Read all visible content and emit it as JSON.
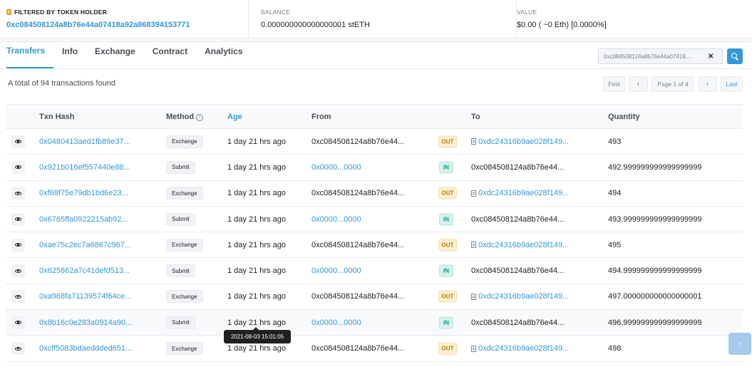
{
  "summary": {
    "filter_label": "FILTERED BY TOKEN HOLDER",
    "holder_address": "0xc084508124a8b76e44a07418a92a868394153771",
    "balance_label": "BALANCE",
    "balance_value": "0.000000000000000001 stETH",
    "value_label": "VALUE",
    "value_value": "$0.00 ( ~0 Eth) [0.0000%]"
  },
  "tabs": [
    "Transfers",
    "Info",
    "Exchange",
    "Contract",
    "Analytics"
  ],
  "active_tab": "Transfers",
  "search": {
    "value": "0xc084508124a8b76e44a07418..."
  },
  "total_text": "A total of 94 transactions found",
  "pager": {
    "first": "First",
    "prev": "‹",
    "page": "Page 1 of 4",
    "next": "›",
    "last": "Last"
  },
  "table": {
    "headers": {
      "hash": "Txn Hash",
      "method": "Method",
      "age": "Age",
      "from": "From",
      "to": "To",
      "qty": "Quantity"
    },
    "rows": [
      {
        "hash": "0x0480413aed1fb89e37...",
        "method": "Exchange",
        "age": "1 day 21 hrs ago",
        "from": "0xc084508124a8b76e44...",
        "from_link": false,
        "dir": "OUT",
        "to": "0xdc24316b9ae028f149...",
        "to_link": true,
        "qty": "493"
      },
      {
        "hash": "0x921b016ef557440e88...",
        "method": "Submit",
        "age": "1 day 21 hrs ago",
        "from": "0x0000...0000",
        "from_link": true,
        "dir": "IN",
        "to": "0xc084508124a8b76e44...",
        "to_link": false,
        "qty": "492.999999999999999999"
      },
      {
        "hash": "0xf68f75e79db1bd6e23...",
        "method": "Exchange",
        "age": "1 day 21 hrs ago",
        "from": "0xc084508124a8b76e44...",
        "from_link": false,
        "dir": "OUT",
        "to": "0xdc24316b9ae028f149...",
        "to_link": true,
        "qty": "494"
      },
      {
        "hash": "0x6765ffa0922215ab92...",
        "method": "Submit",
        "age": "1 day 21 hrs ago",
        "from": "0x0000...0000",
        "from_link": true,
        "dir": "IN",
        "to": "0xc084508124a8b76e44...",
        "to_link": false,
        "qty": "493.999999999999999999"
      },
      {
        "hash": "0xae75c2ec7a6867c967...",
        "method": "Exchange",
        "age": "1 day 21 hrs ago",
        "from": "0xc084508124a8b76e44...",
        "from_link": false,
        "dir": "OUT",
        "to": "0xdc24316b9ae028f149...",
        "to_link": true,
        "qty": "495"
      },
      {
        "hash": "0x625862a7c41defd513...",
        "method": "Submit",
        "age": "1 day 21 hrs ago",
        "from": "0x0000...0000",
        "from_link": true,
        "dir": "IN",
        "to": "0xc084508124a8b76e44...",
        "to_link": false,
        "qty": "494.999999999999999999"
      },
      {
        "hash": "0xa968fa71139574f64ce...",
        "method": "Exchange",
        "age": "1 day 21 hrs ago",
        "from": "0xc084508124a8b76e44...",
        "from_link": false,
        "dir": "OUT",
        "to": "0xdc24316b9ae028f149...",
        "to_link": true,
        "qty": "497.000000000000000001"
      },
      {
        "hash": "0x8b16c0e283a0914a90...",
        "method": "Submit",
        "age": "1 day 21 hrs ago",
        "from": "0x0000...0000",
        "from_link": true,
        "dir": "IN",
        "to": "0xc084508124a8b76e44...",
        "to_link": false,
        "qty": "496.999999999999999999"
      },
      {
        "hash": "0xcff5083bdaeddded651...",
        "method": "Exchange",
        "age": "1 day 21 hrs ago",
        "from": "0xc084508124a8b76e44...",
        "from_link": false,
        "dir": "OUT",
        "to": "0xdc24316b9ae028f149...",
        "to_link": true,
        "qty": "498"
      }
    ]
  },
  "tooltip": "2021-08-03 15:01:05",
  "scroll_top": "↑",
  "colors": {
    "accent": "#3498db",
    "out_badge": "#fcefd2",
    "in_badge": "#d6f2ec"
  },
  "icons": {
    "filter": "token-icon",
    "view": "eye-icon",
    "contract": "document-icon",
    "search": "search-icon",
    "info": "info-icon"
  }
}
